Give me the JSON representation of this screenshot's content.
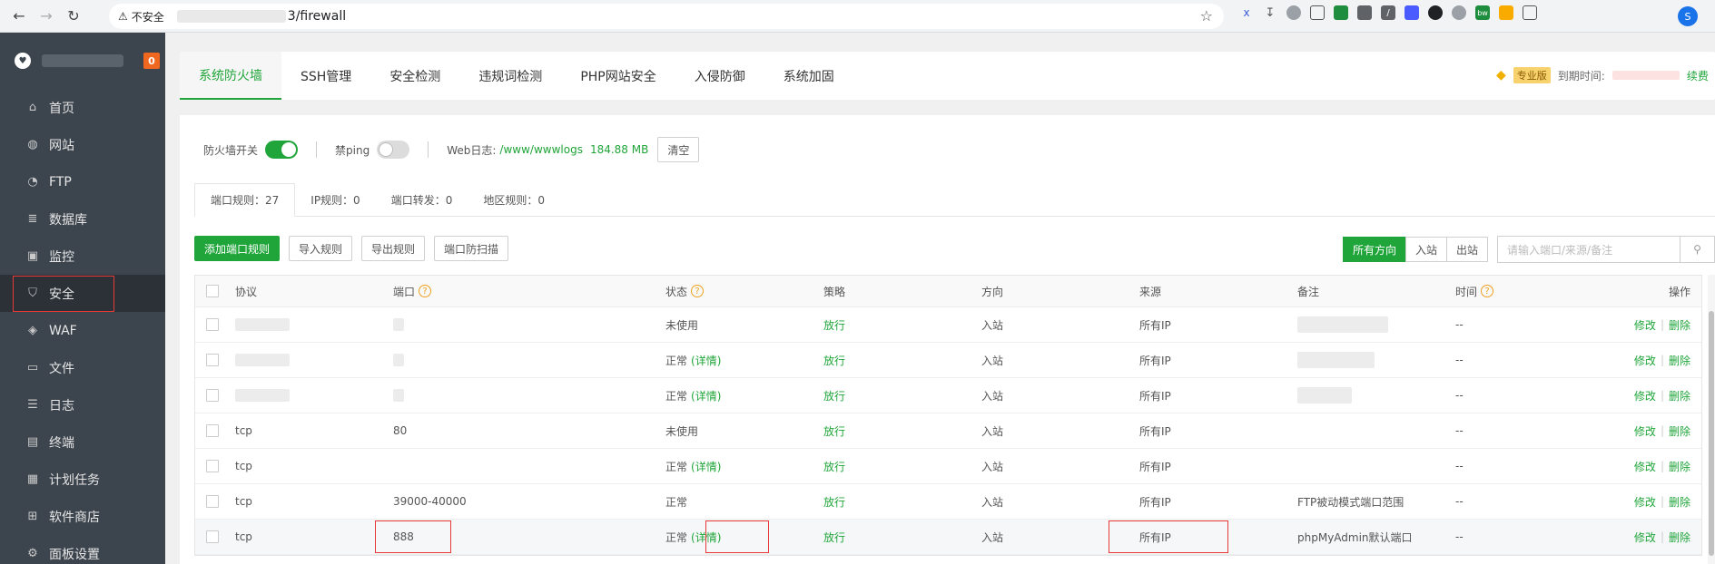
{
  "browser": {
    "security_label": "不安全",
    "url_path": "3/firewall",
    "profile_initial": "S"
  },
  "sidebar": {
    "badge": "0",
    "items": [
      {
        "label": "首页",
        "icon": "home-icon"
      },
      {
        "label": "网站",
        "icon": "globe-icon"
      },
      {
        "label": "FTP",
        "icon": "ftp-icon"
      },
      {
        "label": "数据库",
        "icon": "database-icon"
      },
      {
        "label": "监控",
        "icon": "monitor-icon"
      },
      {
        "label": "安全",
        "icon": "shield-icon"
      },
      {
        "label": "WAF",
        "icon": "waf-icon"
      },
      {
        "label": "文件",
        "icon": "folder-icon"
      },
      {
        "label": "日志",
        "icon": "log-icon"
      },
      {
        "label": "终端",
        "icon": "terminal-icon"
      },
      {
        "label": "计划任务",
        "icon": "calendar-icon"
      },
      {
        "label": "软件商店",
        "icon": "apps-icon"
      },
      {
        "label": "面板设置",
        "icon": "settings-icon"
      }
    ],
    "active_index": 5
  },
  "tabs": [
    "系统防火墙",
    "SSH管理",
    "安全检测",
    "违规词检测",
    "PHP网站安全",
    "入侵防御",
    "系统加固"
  ],
  "pro": {
    "tag": "专业版",
    "expire_label": "到期时间:",
    "renew": "续费"
  },
  "switches": {
    "firewall_label": "防火墙开关",
    "firewall_on": true,
    "ping_label": "禁ping",
    "ping_on": false,
    "weblog_label": "Web日志:",
    "weblog_path": "/www/wwwlogs",
    "weblog_size": "184.88 MB",
    "clear_label": "清空"
  },
  "subtabs": [
    "端口规则：27",
    "IP规则：0",
    "端口转发：0",
    "地区规则：0"
  ],
  "toolbar": {
    "add_label": "添加端口规则",
    "import_label": "导入规则",
    "export_label": "导出规则",
    "scan_label": "端口防扫描",
    "dir_all": "所有方向",
    "dir_in": "入站",
    "dir_out": "出站",
    "search_placeholder": "请输入端口/来源/备注"
  },
  "table": {
    "headers": {
      "protocol": "协议",
      "port": "端口",
      "status": "状态",
      "policy": "策略",
      "direction": "方向",
      "source": "来源",
      "note": "备注",
      "time": "时间",
      "ops": "操作"
    },
    "detail_label": "(详情)",
    "edit_label": "修改",
    "delete_label": "删除",
    "rows": [
      {
        "protocol": "",
        "port": "",
        "status": "未使用",
        "detail": false,
        "policy": "放行",
        "direction": "入站",
        "source": "所有IP",
        "note": "",
        "time": "--"
      },
      {
        "protocol": "",
        "port": "",
        "status": "正常",
        "detail": true,
        "policy": "放行",
        "direction": "入站",
        "source": "所有IP",
        "note": "",
        "time": "--"
      },
      {
        "protocol": "",
        "port": "",
        "status": "正常",
        "detail": true,
        "policy": "放行",
        "direction": "入站",
        "source": "所有IP",
        "note": "",
        "time": "--"
      },
      {
        "protocol": "tcp",
        "port": "80",
        "status": "未使用",
        "detail": false,
        "policy": "放行",
        "direction": "入站",
        "source": "所有IP",
        "note": "",
        "time": "--"
      },
      {
        "protocol": "tcp",
        "port": "",
        "status": "正常",
        "detail": true,
        "policy": "放行",
        "direction": "入站",
        "source": "所有IP",
        "note": "",
        "time": "--"
      },
      {
        "protocol": "tcp",
        "port": "39000-40000",
        "status": "正常",
        "detail": false,
        "policy": "放行",
        "direction": "入站",
        "source": "所有IP",
        "note": "FTP被动模式端口范围",
        "time": "--"
      },
      {
        "protocol": "tcp",
        "port": "888",
        "status": "正常",
        "detail": true,
        "policy": "放行",
        "direction": "入站",
        "source": "所有IP",
        "note": "phpMyAdmin默认端口",
        "time": "--"
      }
    ]
  }
}
